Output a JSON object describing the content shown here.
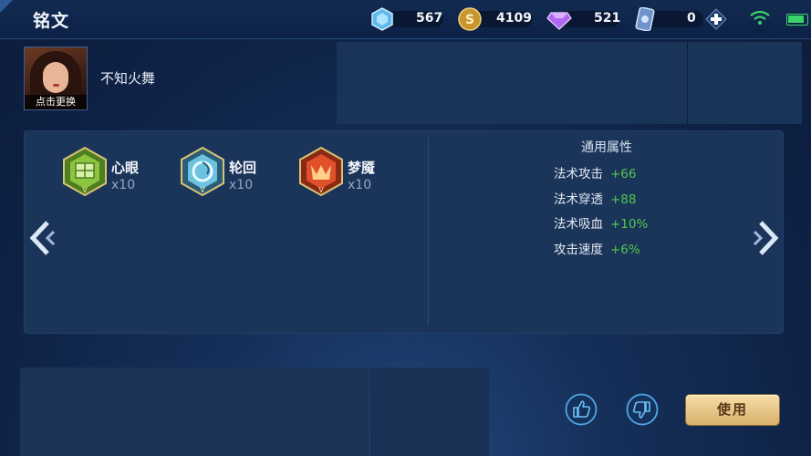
{
  "header": {
    "title": "铭文",
    "resources": [
      {
        "icon": "crystal-icon",
        "value": "567",
        "color": "#8fd6ff"
      },
      {
        "icon": "gold-coin-icon",
        "value": "4109",
        "color": "#e0b04a"
      },
      {
        "icon": "diamond-icon",
        "value": "521",
        "color": "#c07cff"
      },
      {
        "icon": "coupon-icon",
        "value": "0",
        "color": "#9bb8e8"
      }
    ],
    "status": {
      "wifi": "wifi-icon",
      "battery": "battery-icon"
    }
  },
  "hero": {
    "name": "不知火舞",
    "change_label": "点击更换"
  },
  "runes": [
    {
      "name": "心眼",
      "count": "x10",
      "color": "#8bc53f"
    },
    {
      "name": "轮回",
      "count": "x10",
      "color": "#7ad3e8"
    },
    {
      "name": "梦魇",
      "count": "x10",
      "color": "#e0502a"
    }
  ],
  "attributes": {
    "title": "通用属性",
    "items": [
      {
        "name": "法术攻击",
        "value": "+66"
      },
      {
        "name": "法术穿透",
        "value": "+88"
      },
      {
        "name": "法术吸血",
        "value": "+10%"
      },
      {
        "name": "攻击速度",
        "value": "+6%"
      }
    ]
  },
  "actions": {
    "use_label": "使用",
    "like": "thumbs-up-icon",
    "dislike": "thumbs-down-icon"
  },
  "colors": {
    "accent_green": "#4fc94f",
    "gold_button": "#e8c683"
  }
}
